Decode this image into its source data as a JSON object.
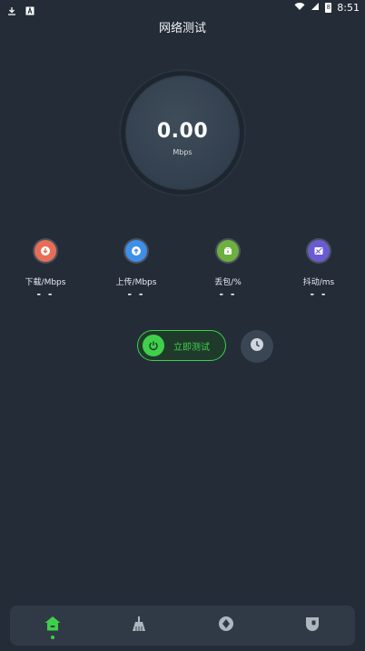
{
  "status_bar": {
    "time": "8:51",
    "battery_level": "8",
    "icons": [
      "download-icon",
      "a-icon",
      "wifi-icon",
      "cell-signal-icon",
      "battery-icon"
    ]
  },
  "header": {
    "title": "网络测试"
  },
  "gauge": {
    "value": "0.00",
    "unit": "Mbps"
  },
  "metrics": [
    {
      "icon": "download-icon",
      "label": "下载/Mbps",
      "value": "- -",
      "color": "#e76d57"
    },
    {
      "icon": "upload-icon",
      "label": "上传/Mbps",
      "value": "- -",
      "color": "#3f8ee8"
    },
    {
      "icon": "packet-loss-icon",
      "label": "丢包/%",
      "value": "- -",
      "color": "#6db040"
    },
    {
      "icon": "jitter-icon",
      "label": "抖动/ms",
      "value": "- -",
      "color": "#6b5bd2"
    }
  ],
  "actions": {
    "start_label": "立即测试",
    "accent_color": "#3ed04a",
    "history_icon": "history-icon"
  },
  "bottom_nav": {
    "items": [
      "home-icon",
      "broom-icon",
      "compass-icon",
      "shield-icon"
    ],
    "active": "home-icon"
  }
}
